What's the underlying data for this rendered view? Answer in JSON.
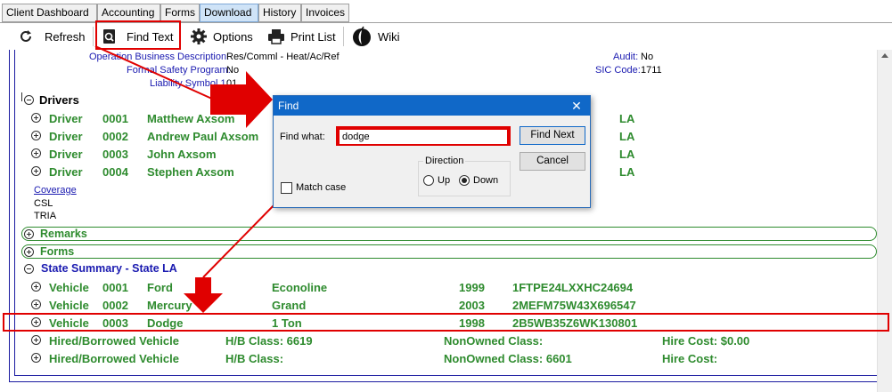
{
  "tabs": [
    {
      "label": "Client Dashboard"
    },
    {
      "label": "Accounting"
    },
    {
      "label": "Forms"
    },
    {
      "label": "Download"
    },
    {
      "label": "History"
    },
    {
      "label": "Invoices"
    }
  ],
  "toolbar": {
    "refresh": "Refresh",
    "find_text": "Find Text",
    "options": "Options",
    "print_list": "Print List",
    "wiki": "Wiki"
  },
  "header_info": {
    "business_desc_label": "Operation Business Description:",
    "business_desc_value": "Res/Comml - Heat/Ac/Ref",
    "safety_label": "Formal Safety Program:",
    "safety_value": "No",
    "liability_label": "Liability Symbol 1:",
    "liability_value": "01",
    "audit_label": "Audit:",
    "audit_value": "No",
    "sic_label": "SIC Code:",
    "sic_value": "1711"
  },
  "drivers": {
    "title": "Drivers",
    "rows": [
      {
        "type": "Driver",
        "num": "0001",
        "name": "Matthew Axsom",
        "state": "LA"
      },
      {
        "type": "Driver",
        "num": "0002",
        "name": "Andrew Paul Axsom",
        "state": "LA"
      },
      {
        "type": "Driver",
        "num": "0003",
        "name": "John Axsom",
        "state": "LA"
      },
      {
        "type": "Driver",
        "num": "0004",
        "name": "Stephen Axsom",
        "state": "LA"
      }
    ]
  },
  "coverage": {
    "link": "Coverage",
    "items": [
      "CSL",
      "TRIA"
    ]
  },
  "sections": {
    "remarks": "Remarks",
    "forms": "Forms"
  },
  "state_summary": {
    "title": "State Summary - State LA",
    "vehicles": [
      {
        "type": "Vehicle",
        "num": "0001",
        "make": "Ford",
        "model": "Econoline",
        "year": "1999",
        "vin": "1FTPE24LXXHC24694"
      },
      {
        "type": "Vehicle",
        "num": "0002",
        "make": "Mercury",
        "model": "Grand",
        "year": "2003",
        "vin": "2MEFM75W43X696547"
      },
      {
        "type": "Vehicle",
        "num": "0003",
        "make": "Dodge",
        "model": "1 Ton",
        "year": "1998",
        "vin": "2B5WB35Z6WK130801"
      }
    ],
    "hired": [
      {
        "type": "Hired/Borrowed Vehicle",
        "hb": "H/B Class: 6619",
        "non": "NonOwned Class:",
        "hire": "Hire Cost: $0.00"
      },
      {
        "type": "Hired/Borrowed Vehicle",
        "hb": "H/B Class:",
        "non": "NonOwned Class: 6601",
        "hire": "Hire Cost:"
      }
    ]
  },
  "find_dialog": {
    "title": "Find",
    "close": "✕",
    "find_what_label": "Find what:",
    "find_what_value": "dodge",
    "find_next": "Find Next",
    "cancel": "Cancel",
    "direction_label": "Direction",
    "up": "Up",
    "down": "Down",
    "match_case": "Match case",
    "direction_selected": "Down",
    "match_case_checked": false
  },
  "colors": {
    "annotation": "#e00000",
    "row_green": "#2e8b2e",
    "section_blue": "#1a1ab0",
    "dialog_title": "#1068c8"
  }
}
